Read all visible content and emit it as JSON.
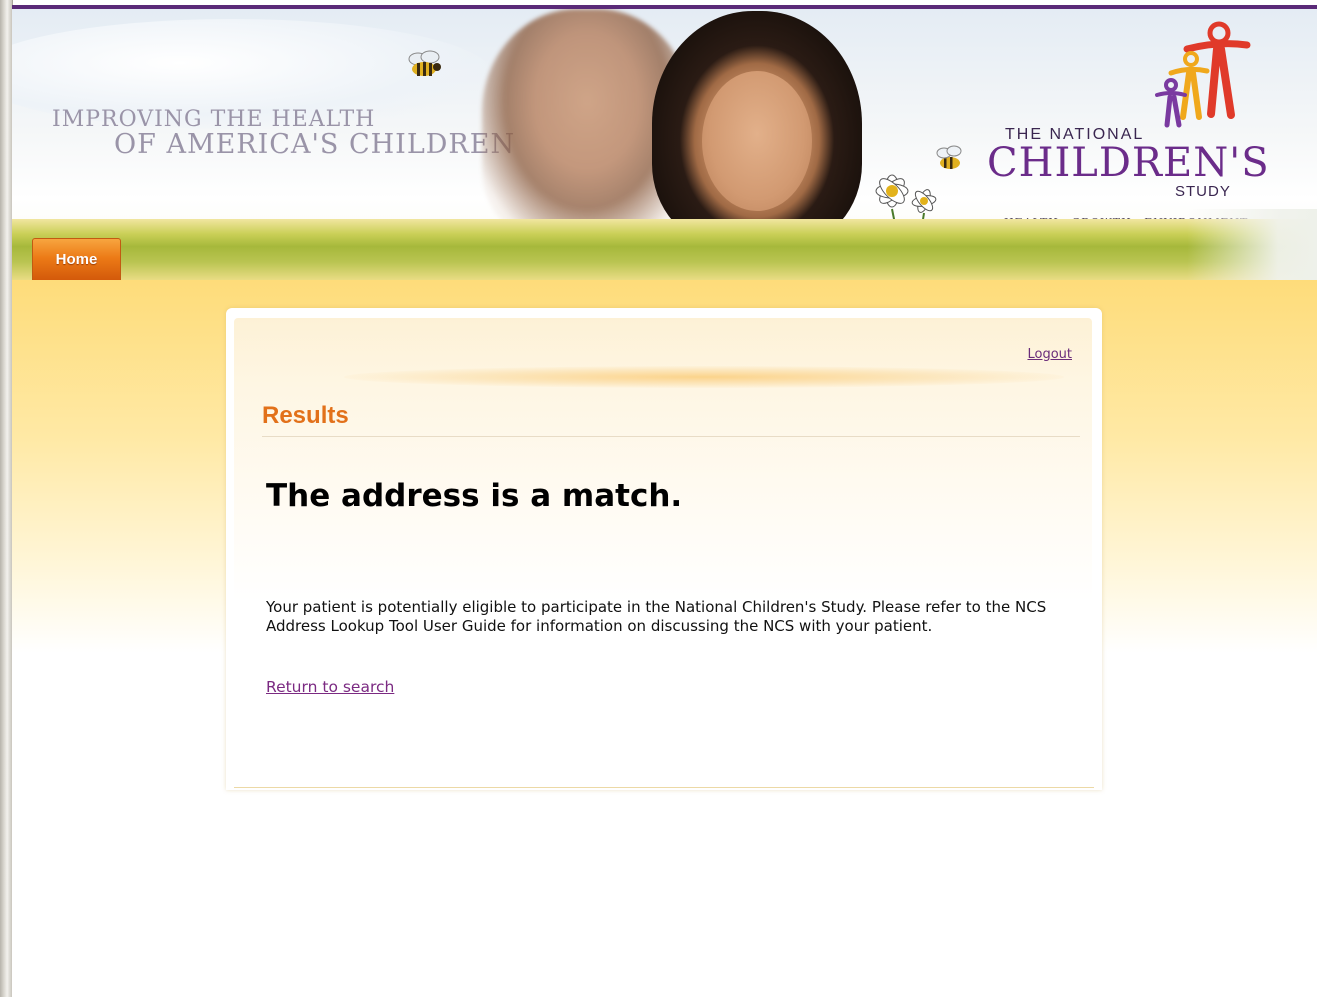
{
  "header": {
    "tagline_line1": "IMPROVING THE HEALTH",
    "tagline_line2": "OF AMERICA'S CHILDREN",
    "logo_the": "THE NATIONAL",
    "logo_main": "CHILDREN'S",
    "logo_study": "STUDY",
    "logo_sub": "HEALTH GROWTH ENVIRONMENT"
  },
  "nav": {
    "home_label": "Home"
  },
  "panel": {
    "logout_label": "Logout",
    "results_title": "Results",
    "match_heading": "The address is a match.",
    "info_text": "Your patient is potentially eligible to participate in the National Children's Study. Please refer to the NCS Address Lookup Tool User Guide for information on discussing the NCS with your patient.",
    "return_link": "Return to search"
  },
  "colors": {
    "brand_purple": "#6b2c8a",
    "accent_orange": "#e2711a",
    "link_purple": "#7b2a82",
    "tab_orange": "#ec7a16"
  },
  "icons": {
    "bee": "bee-icon",
    "logo_figures": "family-figures-logo",
    "flowers": "daisy-flowers"
  }
}
